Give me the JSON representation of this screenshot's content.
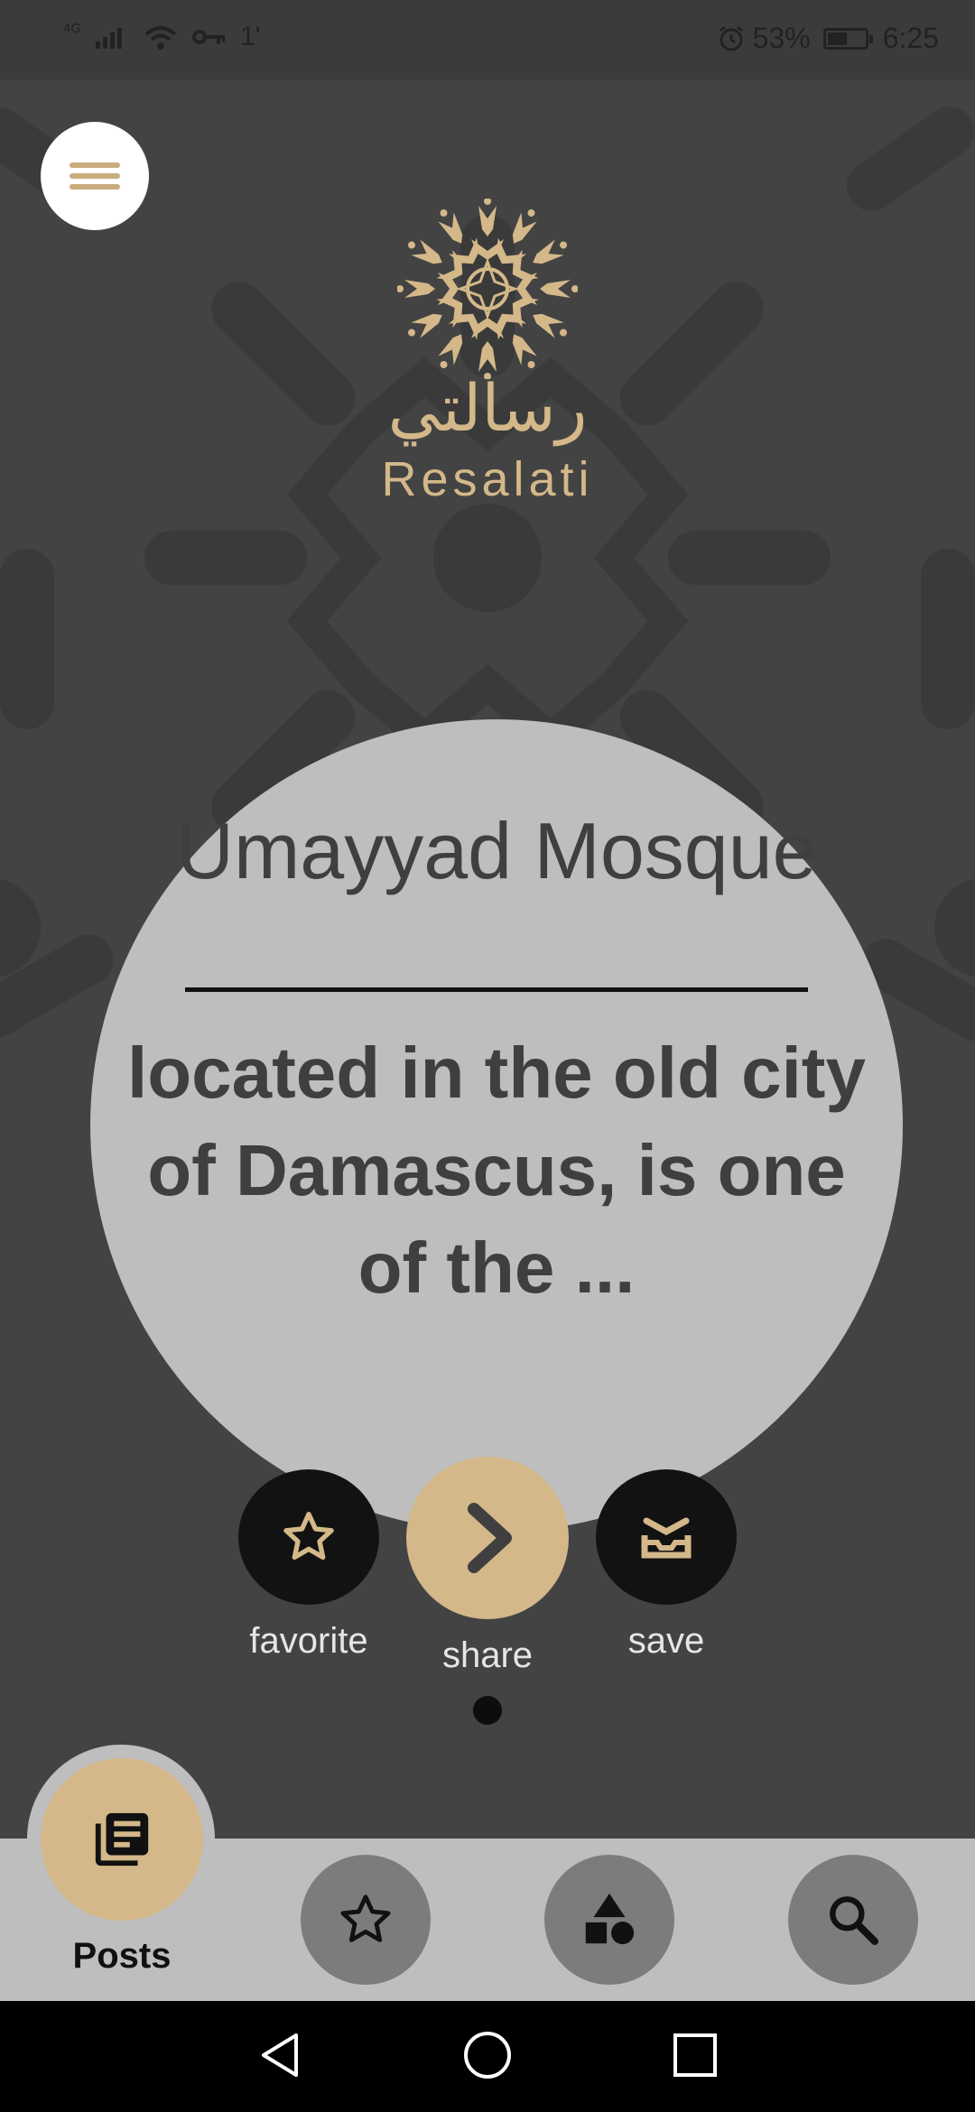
{
  "status_bar": {
    "network_type": "4G",
    "data_indicator": "1'",
    "battery_percent": "53%",
    "battery_level": 0.53,
    "time": "6:25",
    "icons": [
      "signal-icon",
      "wifi-icon",
      "vpn-key-icon",
      "alarm-icon",
      "battery-icon"
    ]
  },
  "header": {
    "menu_icon": "hamburger-menu-icon",
    "logo_arabic": "رسالتي",
    "logo_latin": "Resalati"
  },
  "post": {
    "title": "Umayyad Mosque",
    "excerpt": "located in the old city of Damascus, is one of the ..."
  },
  "actions": {
    "favorite_label": "favorite",
    "share_label": "share",
    "save_label": "save"
  },
  "pager": {
    "current": 1,
    "total": 1
  },
  "bottom_nav": {
    "posts_label": "Posts",
    "items": [
      "posts-icon",
      "star-icon",
      "categories-icon",
      "search-icon"
    ]
  },
  "colors": {
    "accent": "#d4b889",
    "background": "#434343",
    "card": "#bebebe",
    "dark_button": "#121212"
  }
}
